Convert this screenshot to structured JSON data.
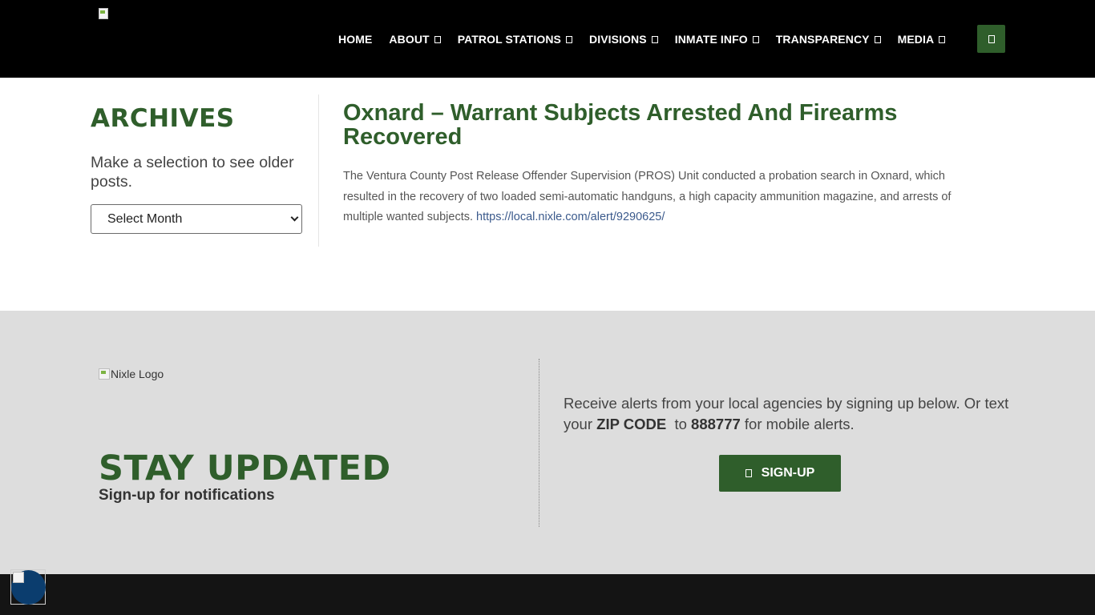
{
  "header": {
    "nav": [
      {
        "label": "HOME",
        "dropdown": false
      },
      {
        "label": "ABOUT",
        "dropdown": true
      },
      {
        "label": "PATROL STATIONS",
        "dropdown": true
      },
      {
        "label": "DIVISIONS",
        "dropdown": true
      },
      {
        "label": "INMATE INFO",
        "dropdown": true
      },
      {
        "label": "TRANSPARENCY",
        "dropdown": true
      },
      {
        "label": "MEDIA",
        "dropdown": true
      }
    ],
    "search_icon": "search-icon"
  },
  "sidebar": {
    "title": "ARCHIVES",
    "description": "Make a selection to see older posts.",
    "select_value": "Select Month"
  },
  "article": {
    "title": "Oxnard – Warrant Subjects Arrested And Firearms Recovered",
    "body": "The Ventura County Post Release Offender Supervision (PROS) Unit conducted a probation search in Oxnard, which resulted in the recovery of two loaded semi-automatic handguns, a high capacity ammunition magazine, and arrests of multiple wanted subjects. ",
    "link": "https://local.nixle.com/alert/9290625/"
  },
  "newsletter": {
    "logo_alt": "Nixle Logo",
    "title": "STAY UPDATED",
    "subtitle": "Sign-up for notifications",
    "alerts_pre": "Receive alerts from your local agencies by signing up below. Or text your ",
    "alerts_zip": "ZIP CODE",
    "alerts_mid": "  to ",
    "alerts_number": "888777",
    "alerts_post": " for mobile alerts.",
    "signup_label": "SIGN-UP"
  },
  "colors": {
    "brand_green": "#2f5e2b",
    "header_bg": "#000000",
    "band_bg": "#dddddd",
    "footer_bg": "#141414"
  }
}
